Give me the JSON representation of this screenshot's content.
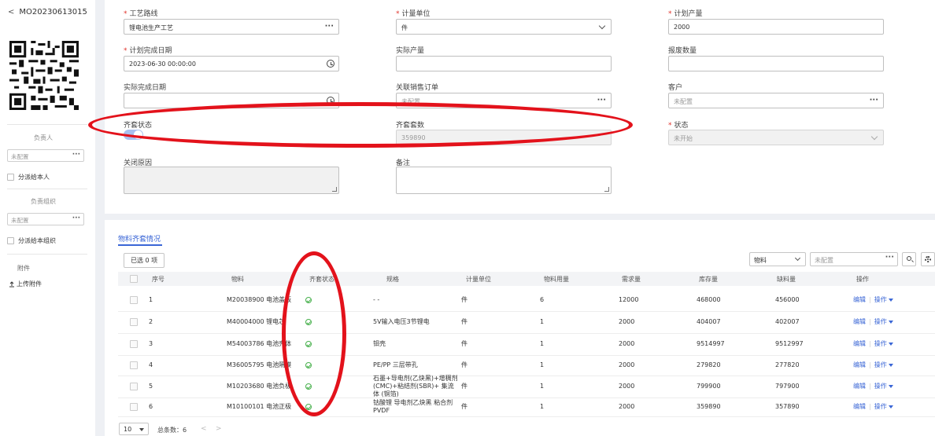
{
  "sidebar": {
    "order_no": "MO20230613015",
    "owner_label": "负责人",
    "owner_value": "未配置",
    "dispatch_self": "分派给本人",
    "org_label": "负责组织",
    "org_value": "未配置",
    "dispatch_org": "分派给本组织",
    "attachment_label": "附件",
    "upload_label": "上传附件"
  },
  "form": {
    "route": {
      "label": "工艺路线",
      "value": "锂电池生产工艺"
    },
    "unit": {
      "label": "计量单位",
      "value": "件"
    },
    "planned_qty": {
      "label": "计划产量",
      "value": "2000"
    },
    "planned_date": {
      "label": "计划完成日期",
      "value": "2023-06-30 00:00:00"
    },
    "actual_qty": {
      "label": "实际产量",
      "value": ""
    },
    "scrap_qty": {
      "label": "报废数量",
      "value": ""
    },
    "actual_date": {
      "label": "实际完成日期",
      "value": ""
    },
    "sales_order": {
      "label": "关联销售订单",
      "placeholder": "未配置"
    },
    "customer": {
      "label": "客户",
      "placeholder": "未配置"
    },
    "kit_status": {
      "label": "齐套状态",
      "on": true
    },
    "kit_count": {
      "label": "齐套套数",
      "value": "359890"
    },
    "status": {
      "label": "状态",
      "value": "未开始"
    },
    "close_reason": {
      "label": "关闭原因"
    },
    "remark": {
      "label": "备注"
    }
  },
  "materials": {
    "tab_label": "物料齐套情况",
    "selected_label": "已选 0 项",
    "filter_field": "物料",
    "filter_placeholder": "未配置",
    "columns": [
      "序号",
      "物料",
      "齐套状态",
      "规格",
      "计量单位",
      "物料用量",
      "需求量",
      "库存量",
      "缺料量",
      "操作"
    ],
    "rows": [
      {
        "no": "1",
        "material": "M20038900 电池盖板",
        "spec": "- -",
        "unit": "件",
        "usage": "6",
        "demand": "12000",
        "stock": "468000",
        "shortage": "456000"
      },
      {
        "no": "2",
        "material": "M40004000 锂电芯",
        "spec": "5V输入电压3节锂电",
        "unit": "件",
        "usage": "1",
        "demand": "2000",
        "stock": "404007",
        "shortage": "402007"
      },
      {
        "no": "3",
        "material": "M54003786 电池壳体",
        "spec": "钼壳",
        "unit": "件",
        "usage": "1",
        "demand": "2000",
        "stock": "9514997",
        "shortage": "9512997"
      },
      {
        "no": "4",
        "material": "M36005795 电池隔膜",
        "spec": "PE/PP 三层带孔",
        "unit": "件",
        "usage": "1",
        "demand": "2000",
        "stock": "279820",
        "shortage": "277820"
      },
      {
        "no": "5",
        "material": "M10203680 电池负极",
        "spec": "石墨+导电剂(乙炔黑)+增稠剂(CMC)+粘结剂(SBR)+ 集流体 (铜箔)",
        "unit": "件",
        "usage": "1",
        "demand": "2000",
        "stock": "799900",
        "shortage": "797900"
      },
      {
        "no": "6",
        "material": "M10100101 电池正极",
        "spec": "钴酸锂 导电剂乙炔黑 粘合剂PVDF",
        "unit": "件",
        "usage": "1",
        "demand": "2000",
        "stock": "359890",
        "shortage": "357890"
      }
    ],
    "edit_label": "编辑",
    "ops_label": "操作",
    "page_size": "10",
    "total_label": "总条数：6",
    "prev": "<",
    "next": ">"
  }
}
